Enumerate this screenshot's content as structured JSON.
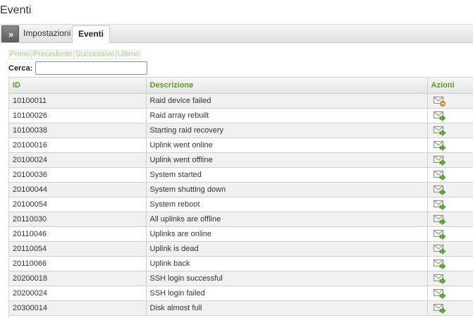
{
  "page": {
    "title": "Eventi"
  },
  "tabs": {
    "toggle_label": "»",
    "items": [
      {
        "label": "Impostazioni",
        "active": false
      },
      {
        "label": "Eventi",
        "active": true
      }
    ]
  },
  "pager": {
    "first": "Primo",
    "previous": "Precedente",
    "next": "Successivo",
    "last": "Ultimo"
  },
  "search": {
    "label": "Cerca:",
    "value": "",
    "placeholder": ""
  },
  "table": {
    "headers": {
      "id": "ID",
      "description": "Descrizione",
      "actions": "Azioni"
    },
    "rows": [
      {
        "id": "10100011",
        "description": "Raid device failed",
        "action_icon": "mail-disabled-icon"
      },
      {
        "id": "10100026",
        "description": "Raid array rebuilt",
        "action_icon": "mail-send-icon"
      },
      {
        "id": "10100038",
        "description": "Starting raid recovery",
        "action_icon": "mail-send-icon"
      },
      {
        "id": "20100016",
        "description": "Uplink went online",
        "action_icon": "mail-send-icon"
      },
      {
        "id": "20100024",
        "description": "Uplink went offline",
        "action_icon": "mail-send-icon"
      },
      {
        "id": "20100036",
        "description": "System started",
        "action_icon": "mail-send-icon"
      },
      {
        "id": "20100044",
        "description": "System shutting down",
        "action_icon": "mail-send-icon"
      },
      {
        "id": "20100054",
        "description": "System reboot",
        "action_icon": "mail-send-icon"
      },
      {
        "id": "20110030",
        "description": "All uplinks are offline",
        "action_icon": "mail-send-icon"
      },
      {
        "id": "20110046",
        "description": "Uplinks are online",
        "action_icon": "mail-send-icon"
      },
      {
        "id": "20110054",
        "description": "Uplink is dead",
        "action_icon": "mail-send-icon"
      },
      {
        "id": "20110066",
        "description": "Uplink back",
        "action_icon": "mail-send-icon"
      },
      {
        "id": "20200018",
        "description": "SSH login successful",
        "action_icon": "mail-send-icon"
      },
      {
        "id": "20200024",
        "description": "SSH login failed",
        "action_icon": "mail-send-icon"
      },
      {
        "id": "20300014",
        "description": "Disk almost full",
        "action_icon": "mail-send-icon"
      }
    ]
  },
  "colors": {
    "header_text": "#5a9e1f",
    "pager_text": "#9ccc7c",
    "row_alt": "#f1f1f1"
  }
}
